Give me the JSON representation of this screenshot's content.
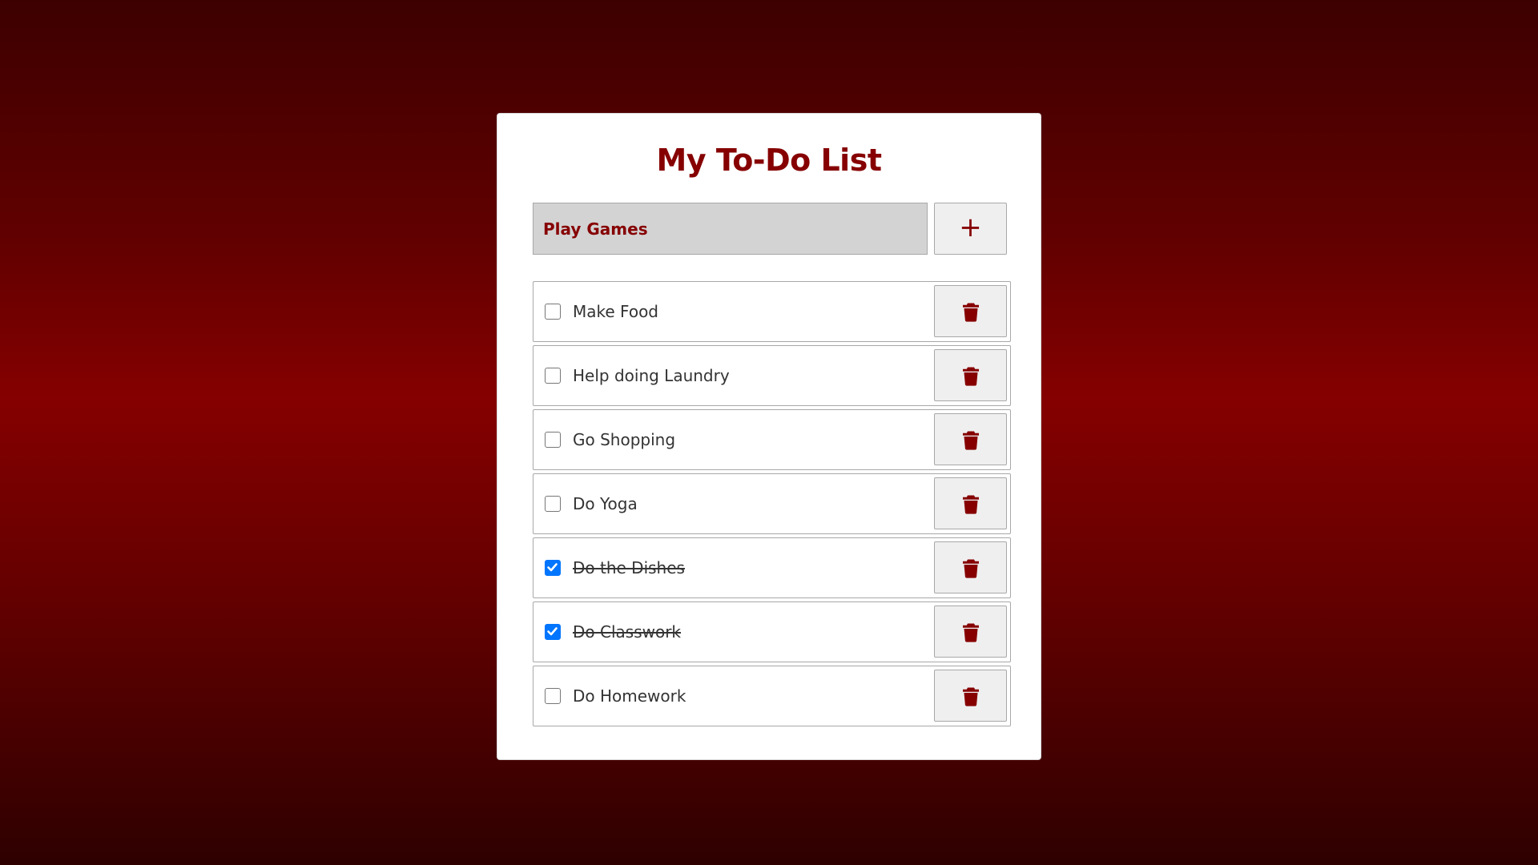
{
  "app": {
    "title": "My To-Do List"
  },
  "input": {
    "value": "Play Games",
    "add_label": "+"
  },
  "todos": [
    {
      "label": "Make Food",
      "done": false
    },
    {
      "label": "Help doing Laundry",
      "done": false
    },
    {
      "label": "Go Shopping",
      "done": false
    },
    {
      "label": "Do Yoga",
      "done": false
    },
    {
      "label": "Do the Dishes",
      "done": true
    },
    {
      "label": "Do Classwork",
      "done": true
    },
    {
      "label": "Do Homework",
      "done": false
    }
  ],
  "colors": {
    "accent": "#860000",
    "checked": "#0075ff",
    "background_mid": "#850000"
  },
  "icons": {
    "add": "plus-icon",
    "delete": "trash-icon"
  }
}
